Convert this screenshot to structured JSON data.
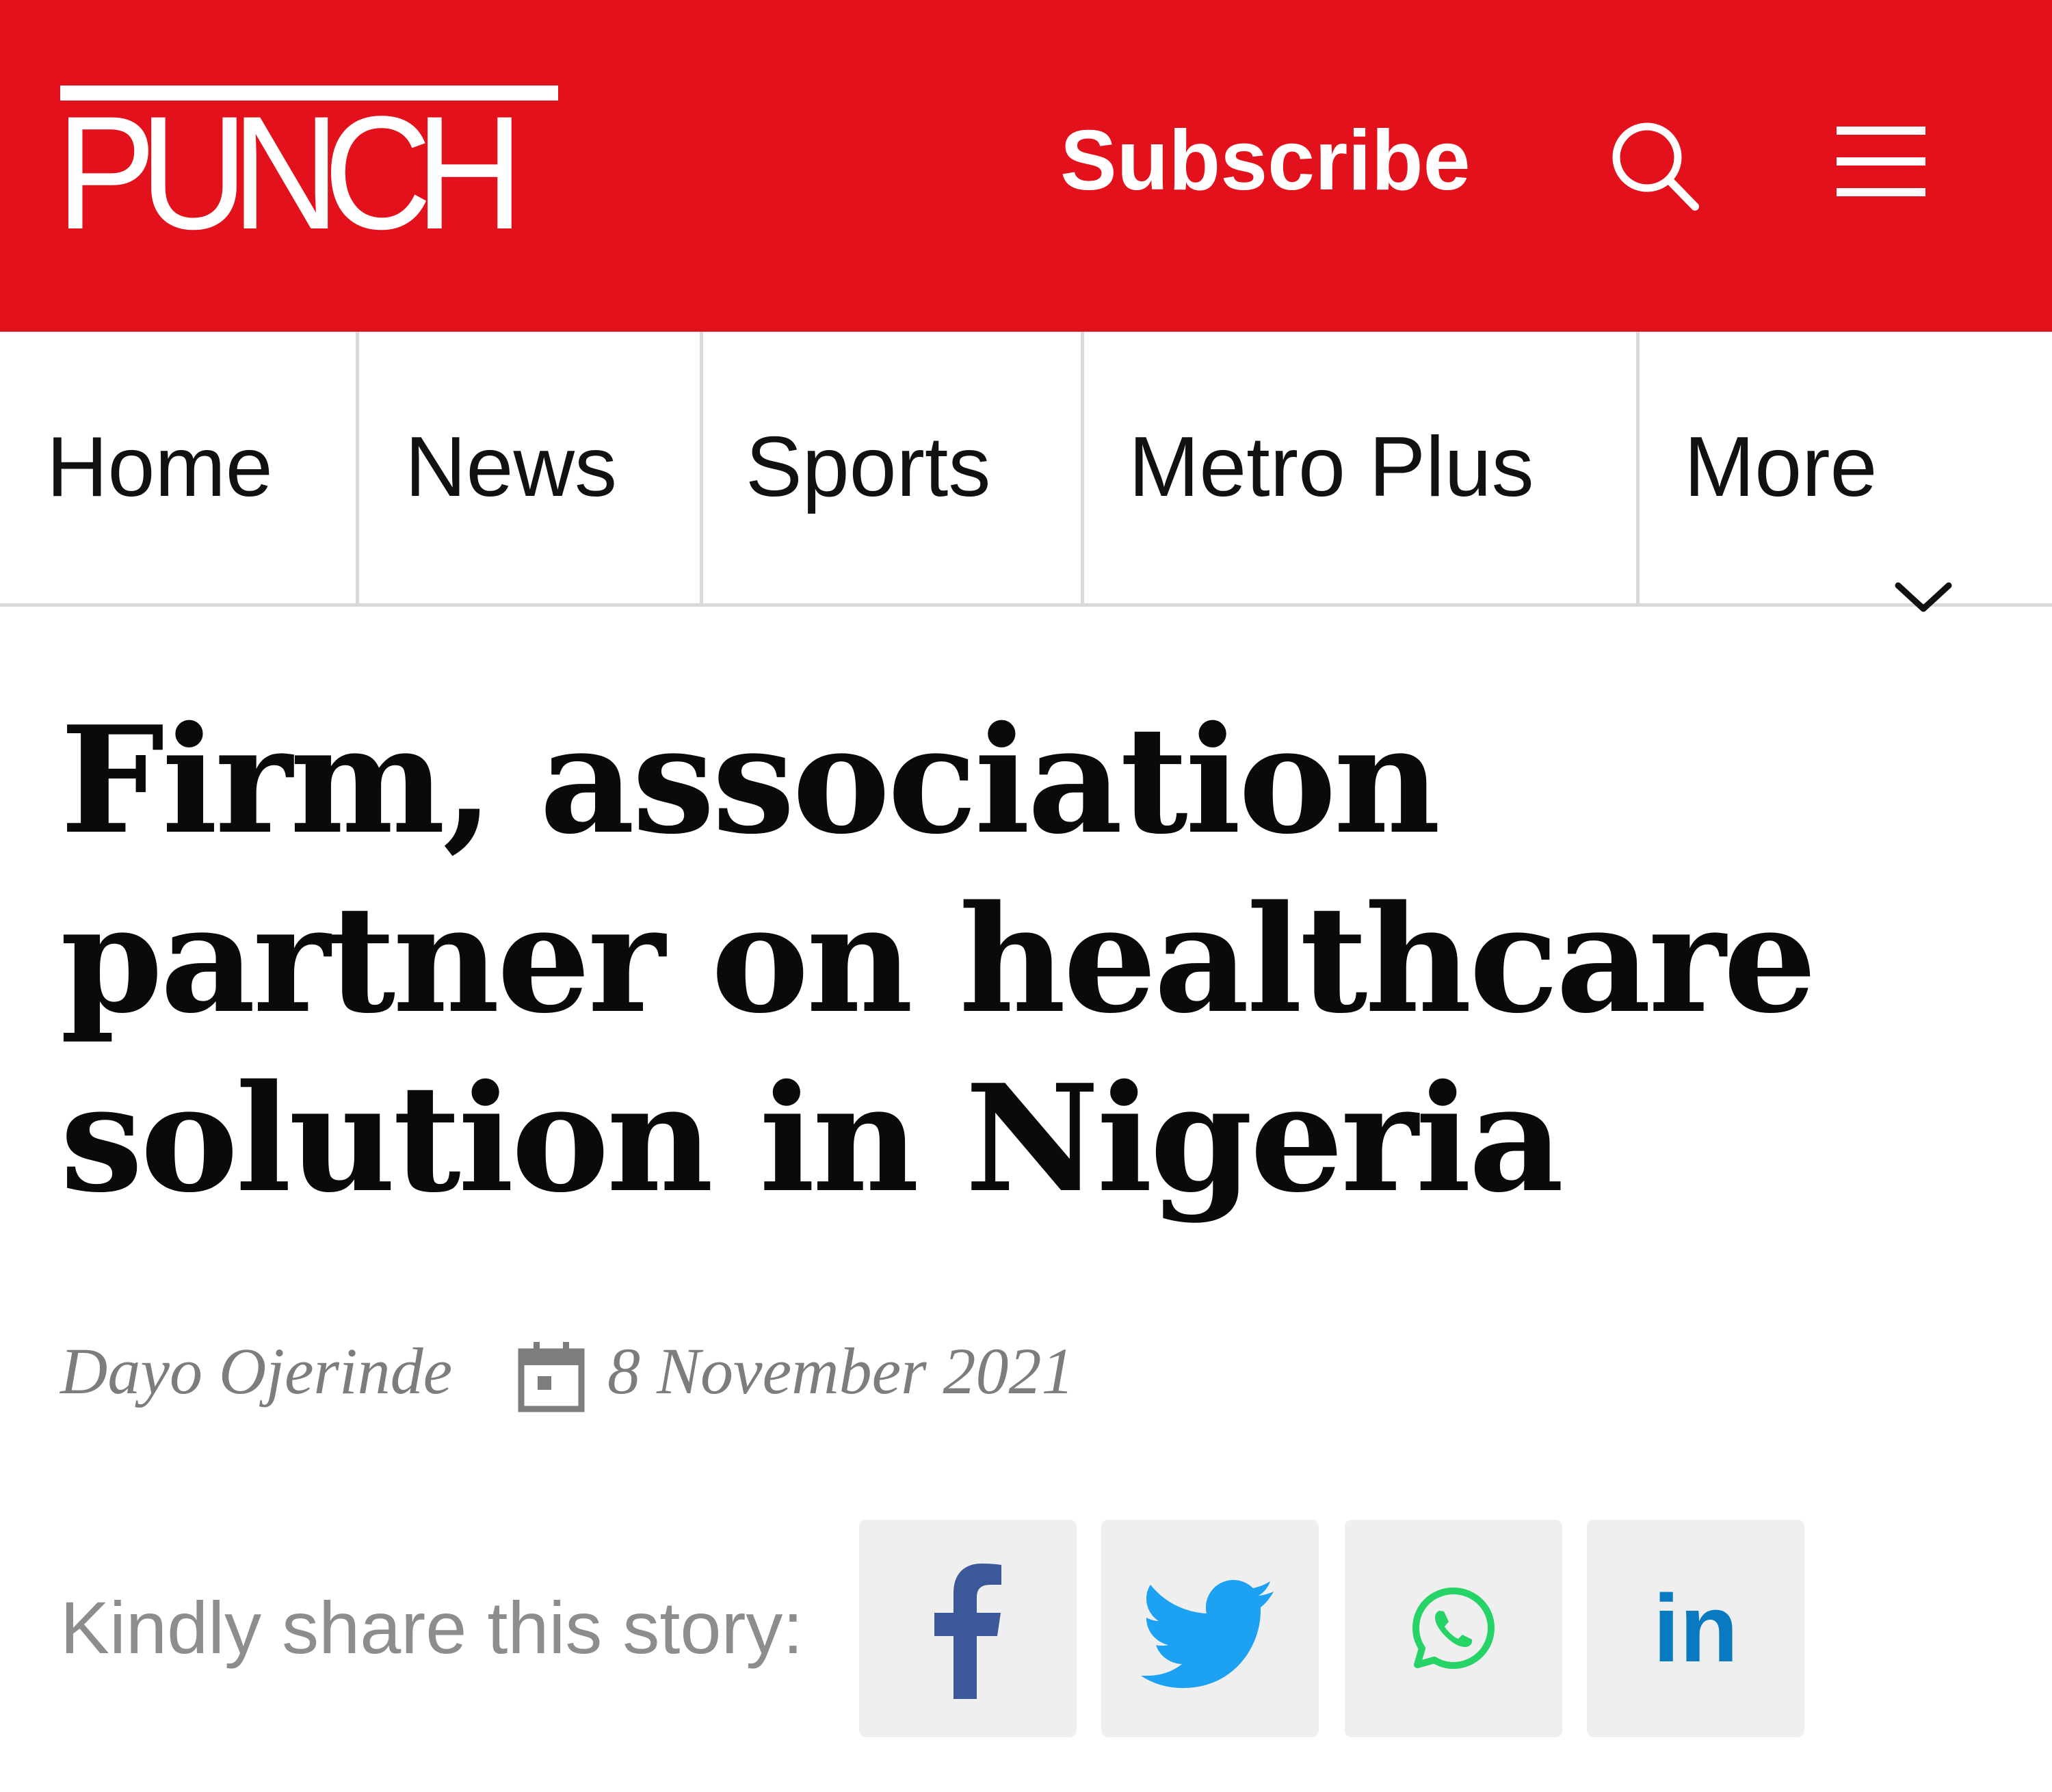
{
  "header": {
    "logo_text": "PUNCH",
    "subscribe_label": "Subscribe",
    "search_icon": "search-icon",
    "menu_icon": "hamburger-menu-icon",
    "brand_color": "#e2111b"
  },
  "nav": {
    "items": [
      {
        "label": "Home"
      },
      {
        "label": "News"
      },
      {
        "label": "Sports"
      },
      {
        "label": "Metro Plus"
      },
      {
        "label": "More"
      }
    ],
    "more_icon": "chevron-down-icon"
  },
  "article": {
    "headline": "Firm, association partner on healthcare solution in Nigeria",
    "author": "Dayo Ojerinde",
    "date_icon": "calendar-icon",
    "date": "8 November 2021"
  },
  "share": {
    "label": "Kindly share this story:",
    "buttons": [
      {
        "network": "facebook",
        "icon": "facebook-icon",
        "color": "#3b5998"
      },
      {
        "network": "twitter",
        "icon": "twitter-icon",
        "color": "#1da1f2"
      },
      {
        "network": "whatsapp",
        "icon": "whatsapp-icon",
        "color": "#25d366"
      },
      {
        "network": "linkedin",
        "icon": "linkedin-icon",
        "text": "in",
        "color": "#0a7ac0"
      }
    ]
  }
}
